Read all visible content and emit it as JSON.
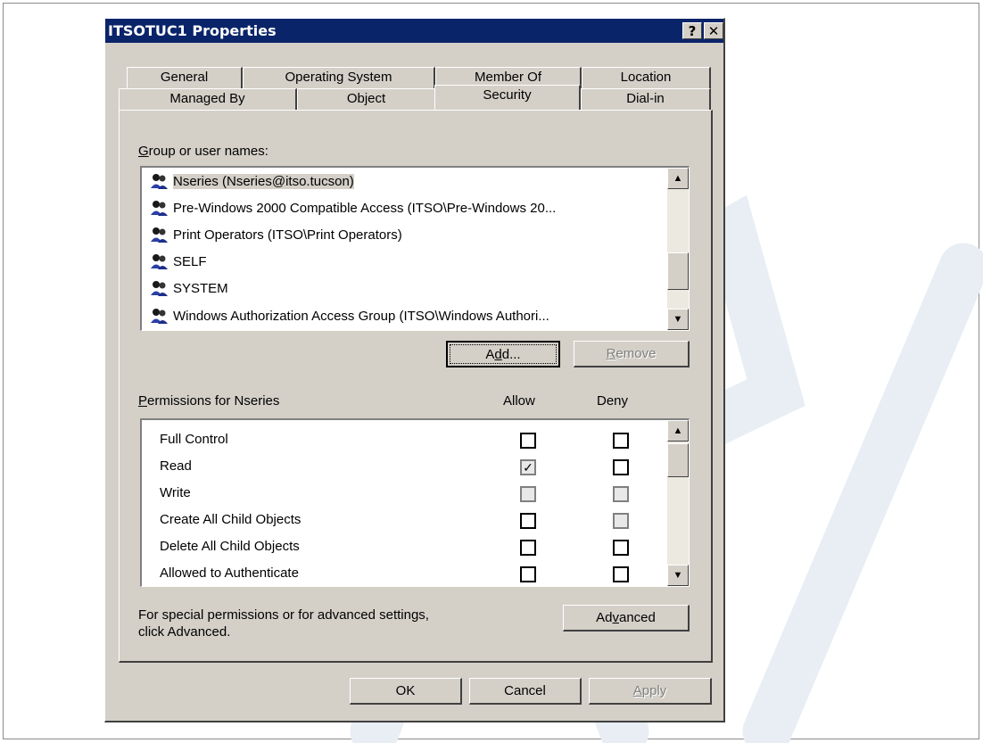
{
  "window": {
    "title": "ITSOTUC1 Properties",
    "help_button": "?",
    "close_button": "✕"
  },
  "tabs": {
    "back_row": [
      "General",
      "Operating System",
      "Member Of",
      "Location"
    ],
    "front_row": [
      "Managed By",
      "Object",
      "Security",
      "Dial-in"
    ],
    "active": "Security"
  },
  "groups": {
    "label": "Group or user names:",
    "items": [
      "Nseries (Nseries@itso.tucson)",
      "Pre-Windows 2000 Compatible Access (ITSO\\Pre-Windows 20...",
      "Print Operators (ITSO\\Print Operators)",
      "SELF",
      "SYSTEM",
      "Windows Authorization Access Group (ITSO\\Windows Authori..."
    ],
    "selected_index": 0
  },
  "buttons": {
    "add": "Add...",
    "remove": "Remove",
    "advanced": "Advanced",
    "ok": "OK",
    "cancel": "Cancel",
    "apply": "Apply"
  },
  "permissions": {
    "label": "Permissions for Nseries",
    "allow_header": "Allow",
    "deny_header": "Deny",
    "rows": [
      {
        "name": "Full Control",
        "allow": false,
        "deny": false,
        "allow_disabled": false,
        "deny_disabled": false
      },
      {
        "name": "Read",
        "allow": true,
        "deny": false,
        "allow_disabled": true,
        "deny_disabled": false
      },
      {
        "name": "Write",
        "allow": false,
        "deny": false,
        "allow_disabled": true,
        "deny_disabled": true
      },
      {
        "name": "Create All Child Objects",
        "allow": false,
        "deny": false,
        "allow_disabled": false,
        "deny_disabled": true
      },
      {
        "name": "Delete All Child Objects",
        "allow": false,
        "deny": false,
        "allow_disabled": false,
        "deny_disabled": false
      },
      {
        "name": "Allowed to Authenticate",
        "allow": false,
        "deny": false,
        "allow_disabled": false,
        "deny_disabled": false
      }
    ]
  },
  "advanced_text": [
    "For special permissions or for advanced settings,",
    "click Advanced."
  ],
  "watermark": "Draft",
  "colors": {
    "titlebar": "#0a246a",
    "face": "#d4d0c8",
    "watermark": "#e8eef4"
  }
}
